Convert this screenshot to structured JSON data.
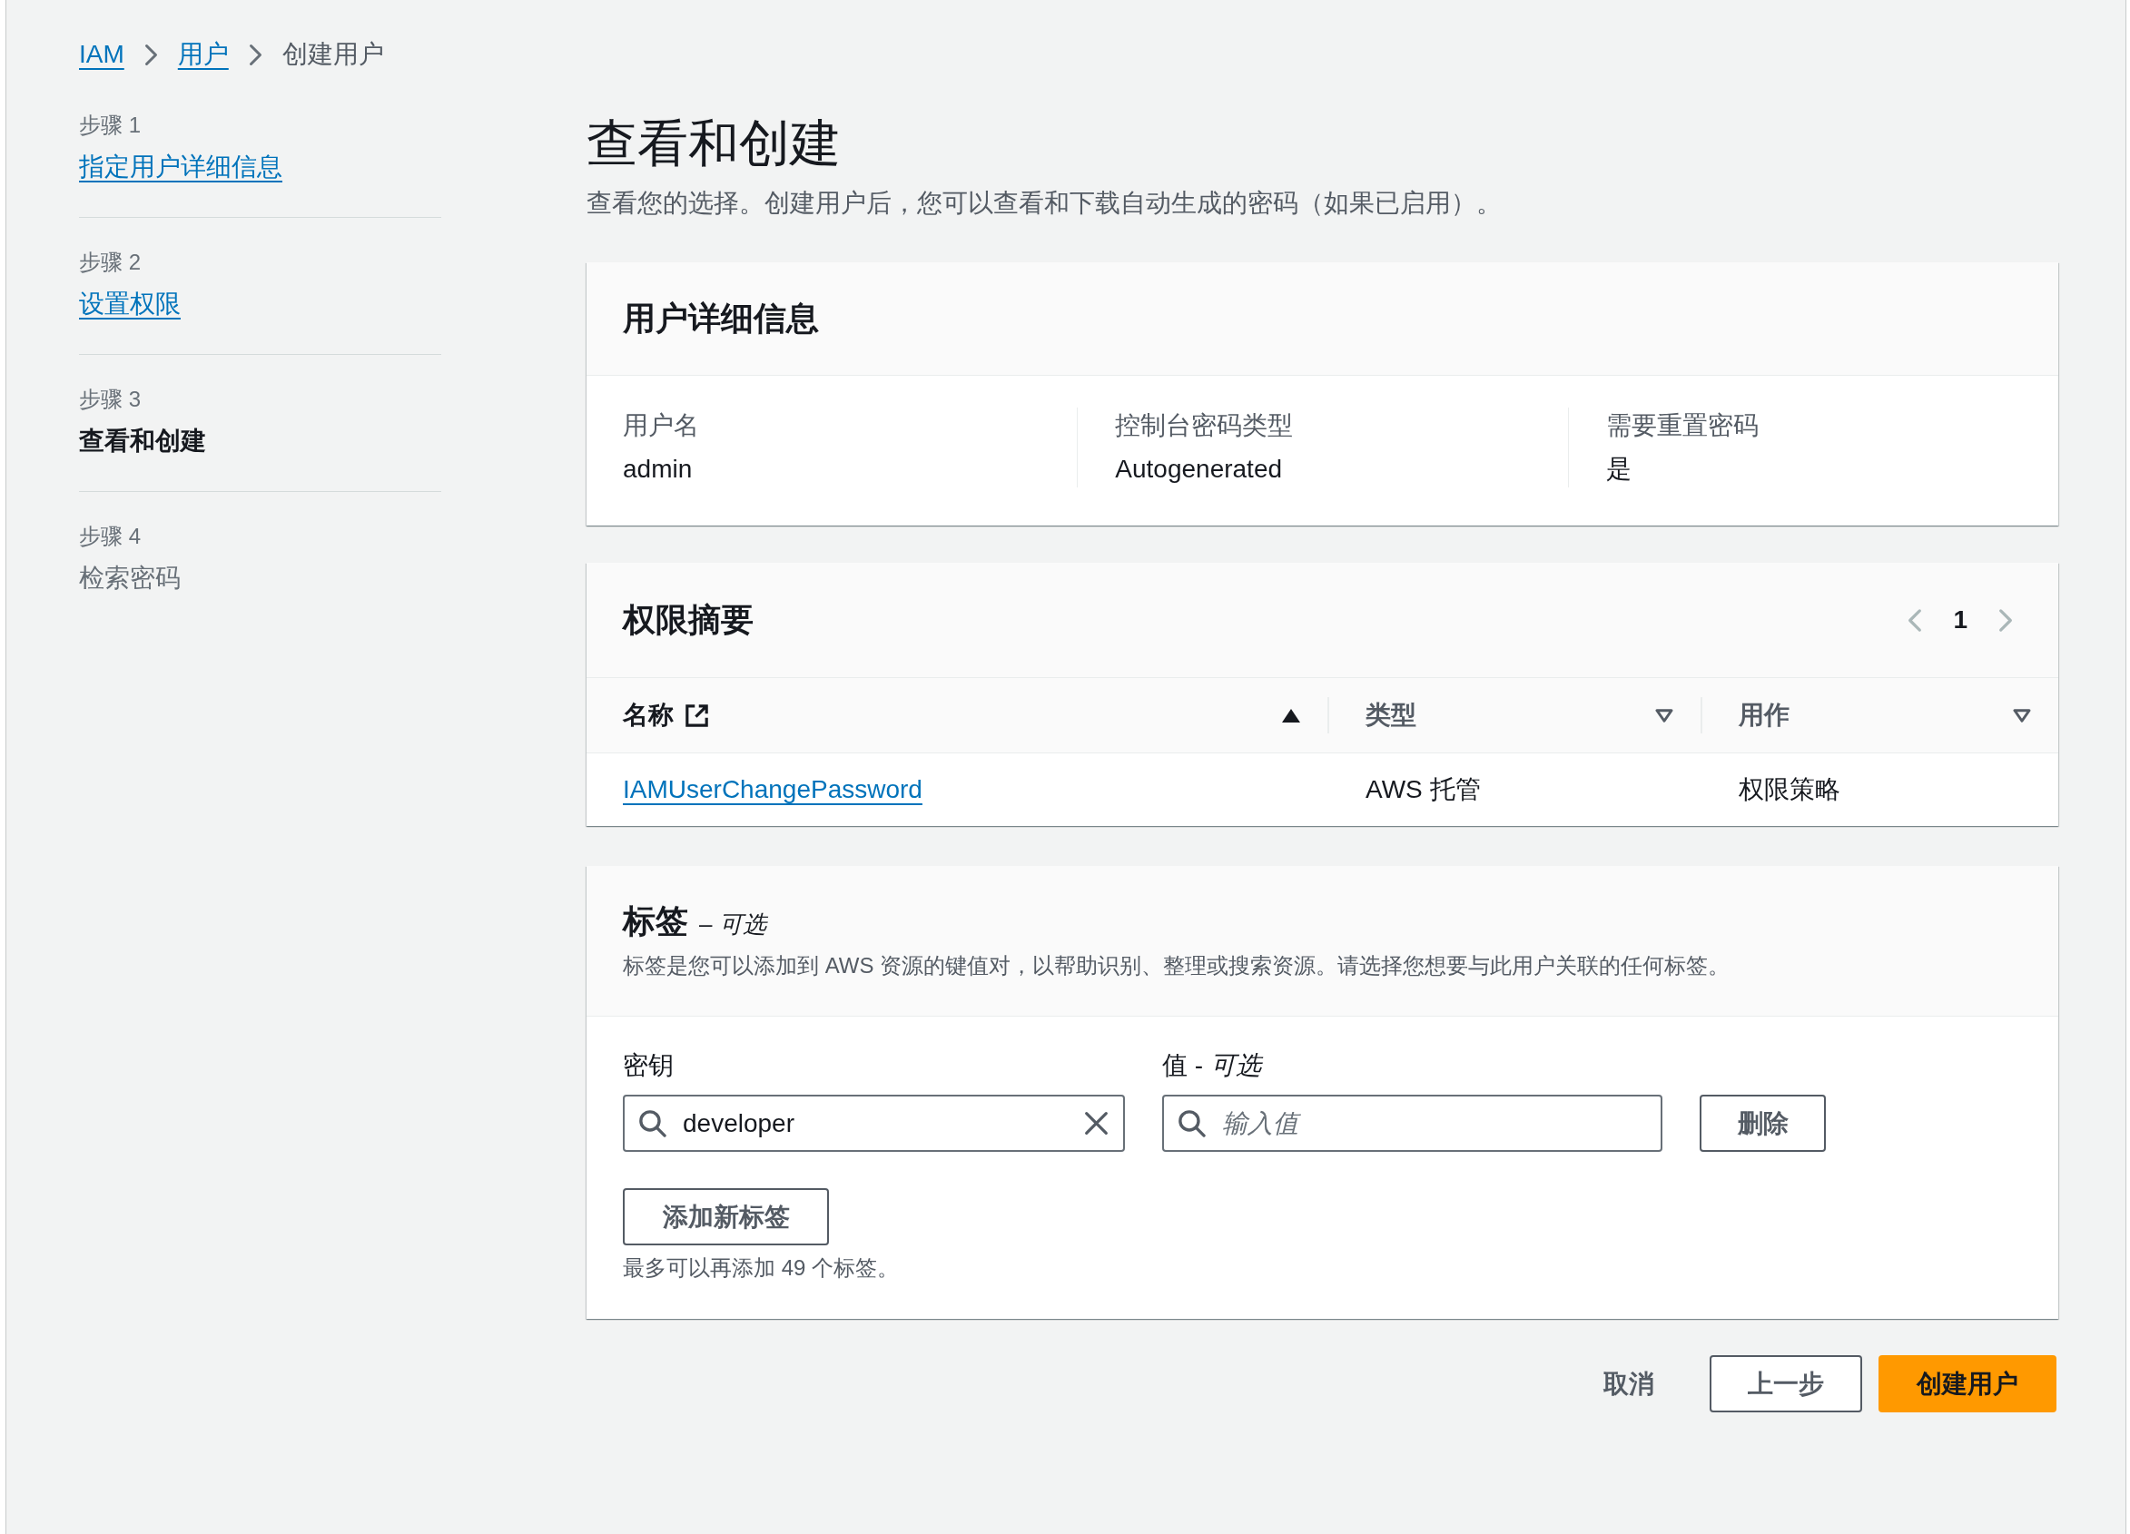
{
  "breadcrumb": [
    {
      "label": "IAM",
      "kind": "link"
    },
    {
      "label": "用户",
      "kind": "link"
    },
    {
      "label": "创建用户",
      "kind": "current"
    }
  ],
  "steps": [
    {
      "label": "步骤 1",
      "title": "指定用户详细信息",
      "selected": false,
      "disabled": false
    },
    {
      "label": "步骤 2",
      "title": "设置权限",
      "selected": false,
      "disabled": false
    },
    {
      "label": "步骤 3",
      "title": "查看和创建",
      "selected": true,
      "disabled": false
    },
    {
      "label": "步骤 4",
      "title": "检索密码",
      "selected": false,
      "disabled": true
    }
  ],
  "page": {
    "title": "查看和创建",
    "description": "查看您的选择。创建用户后，您可以查看和下载自动生成的密码（如果已启用）。"
  },
  "user_details": {
    "title": "用户详细信息",
    "fields": [
      {
        "label": "用户名",
        "value": "admin"
      },
      {
        "label": "控制台密码类型",
        "value": "Autogenerated"
      },
      {
        "label": "需要重置密码",
        "value": "是"
      }
    ]
  },
  "permissions": {
    "title": "权限摘要",
    "pagination": {
      "prev_disabled": true,
      "pages": [
        {
          "label": "1",
          "selected": true
        }
      ],
      "next_disabled": true
    },
    "columns": [
      {
        "label": "名称",
        "external_link": true,
        "sorted": true
      },
      {
        "label": "类型",
        "external_link": false,
        "sorted": false
      },
      {
        "label": "用作",
        "external_link": false,
        "sorted": false
      }
    ],
    "rows": [
      {
        "cells": [
          {
            "text": "IAMUserChangePassword",
            "kind": "link"
          },
          {
            "text": "AWS 托管",
            "kind": "text"
          },
          {
            "text": "权限策略",
            "kind": "text"
          }
        ]
      }
    ]
  },
  "tags": {
    "title": "标签",
    "title_note": "– *可选*",
    "description": "标签是您可以添加到 AWS 资源的键值对，以帮助识别、整理或搜索资源。请选择您想要与此用户关联的任何标签。",
    "key_label": "密钥",
    "value_label": "值 - *可选*",
    "items": [
      {
        "key": {
          "value": "developer"
        },
        "value": {
          "placeholder": "输入值"
        },
        "remove": "删除"
      }
    ],
    "add": "添加新标签",
    "limit_note": "最多可以再添加 49 个标签。"
  },
  "actions": [
    {
      "label": "取消",
      "kind": "link"
    },
    {
      "label": "上一步",
      "kind": "normal"
    },
    {
      "label": "创建用户",
      "kind": "primary"
    }
  ]
}
